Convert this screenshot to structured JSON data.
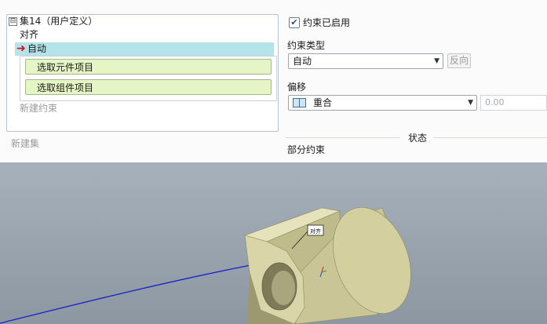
{
  "tree": {
    "expander": "⊟",
    "set_label": "集14（用户定义）",
    "align_label": "对齐",
    "auto_label": "自动",
    "ref_component": "选取元件项目",
    "ref_assembly": "选取组件项目",
    "new_constraint": "新建约束",
    "new_set": "新建集"
  },
  "constraint": {
    "enabled_label": "约束已启用",
    "enabled": true,
    "type_heading": "约束类型",
    "type_value": "自动",
    "flip_label": "反向",
    "offset_heading": "偏移",
    "offset_value": "重合",
    "offset_number": "0.00"
  },
  "status": {
    "heading": "状态",
    "value": "部分约束"
  },
  "viewport": {
    "callout_label": "对齐",
    "background_color": "#9aa4af",
    "model_color": "#d8d4a6",
    "curve_color": "#1420c8"
  }
}
